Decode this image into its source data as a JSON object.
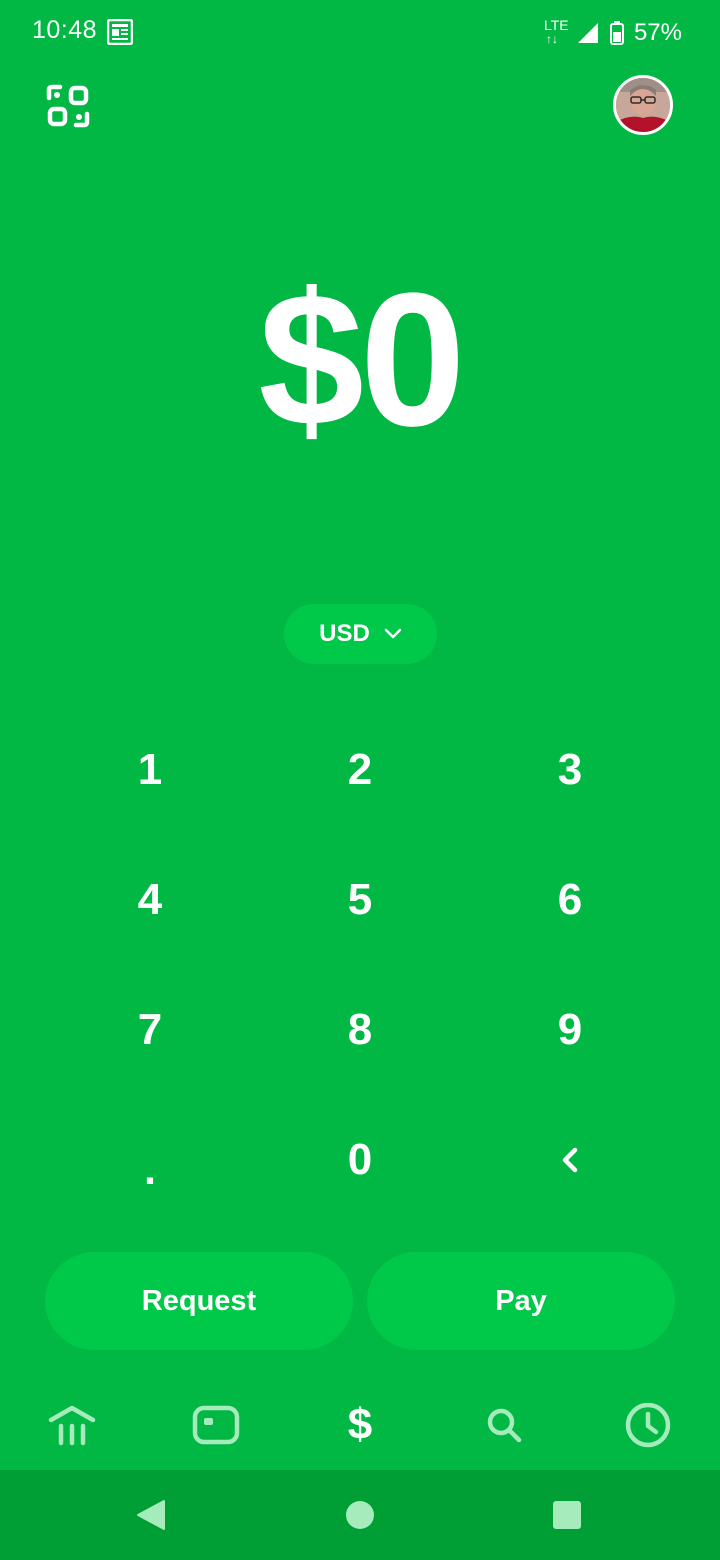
{
  "status_bar": {
    "time": "10:48",
    "network": "LTE",
    "network_arrows": "↑↓",
    "battery": "57%"
  },
  "header": {
    "qr_icon": "qr-scan-icon",
    "avatar_icon": "profile-avatar"
  },
  "amount": {
    "display": "$0"
  },
  "currency": {
    "selected": "USD"
  },
  "keypad": {
    "keys": [
      "1",
      "2",
      "3",
      "4",
      "5",
      "6",
      "7",
      "8",
      "9",
      ".",
      "0",
      "‹"
    ]
  },
  "actions": {
    "request_label": "Request",
    "pay_label": "Pay"
  },
  "tab_bar": {
    "dollar_label": "$",
    "icons": [
      "bank-icon",
      "card-icon",
      "dollar-icon",
      "search-icon",
      "clock-icon"
    ]
  },
  "colors": {
    "background": "#00b843",
    "button": "#00c94a",
    "nav_bar": "#009f36",
    "inactive_icon": "#a5ebbc"
  }
}
